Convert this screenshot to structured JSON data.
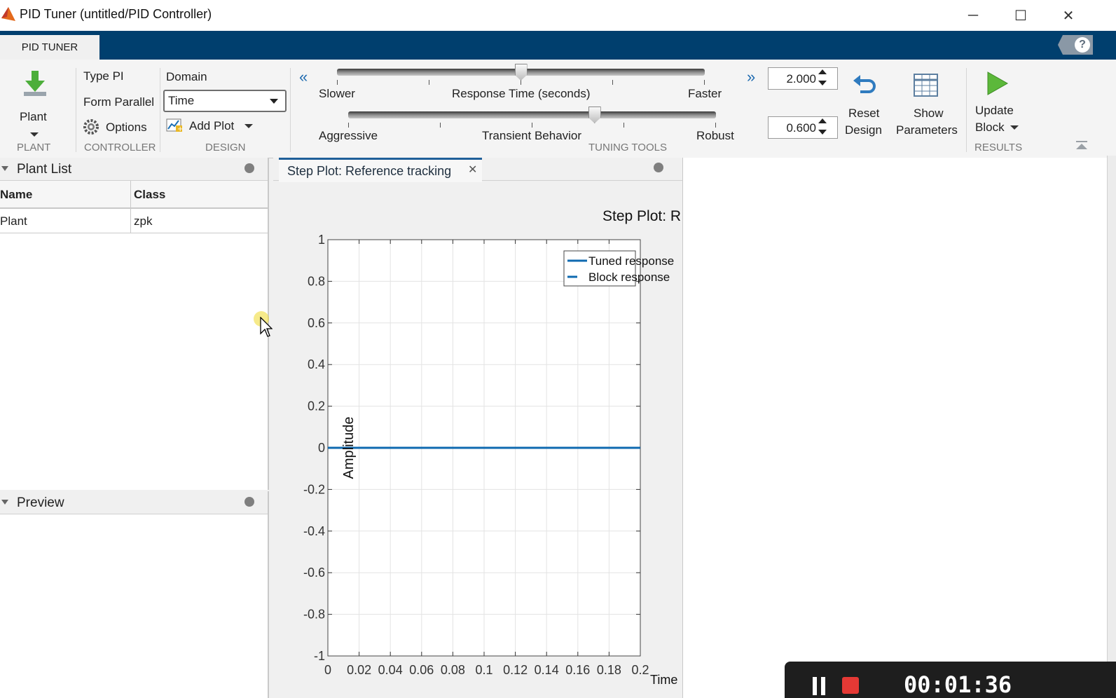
{
  "window": {
    "title": "PID Tuner (untitled/PID Controller)",
    "minimize": "─",
    "maximize": "☐",
    "close": "✕"
  },
  "tabs": {
    "active": "PID TUNER",
    "help": "?"
  },
  "ribbon": {
    "plant": {
      "button": "Plant",
      "group": "PLANT"
    },
    "controller": {
      "type": "Type PI",
      "form": "Form Parallel",
      "options": "Options",
      "group": "CONTROLLER"
    },
    "design": {
      "domain_label": "Domain",
      "domain_value": "Time",
      "add_plot": "Add Plot",
      "group": "DESIGN"
    },
    "tuning": {
      "slower": "Slower",
      "response_time": "Response Time (seconds)",
      "faster": "Faster",
      "aggressive": "Aggressive",
      "transient": "Transient Behavior",
      "robust": "Robust",
      "response_time_value": "2.000",
      "transient_value": "0.600",
      "response_slider_fraction": 0.5,
      "transient_slider_fraction": 0.67,
      "group": "TUNING TOOLS"
    },
    "reset": {
      "line1": "Reset",
      "line2": "Design"
    },
    "show": {
      "line1": "Show",
      "line2": "Parameters"
    },
    "results": {
      "line1": "Update",
      "line2": "Block",
      "group": "RESULTS"
    }
  },
  "plant_list": {
    "title": "Plant List",
    "columns": [
      "Name",
      "Class"
    ],
    "rows": [
      {
        "name": "Plant",
        "class": "zpk"
      }
    ]
  },
  "preview": {
    "title": "Preview"
  },
  "plot_tab": {
    "title": "Step Plot: Reference tracking"
  },
  "colors": {
    "accent": "#003f6e",
    "line": "#0f6ab0"
  },
  "chart_data": {
    "type": "line",
    "title": "Step Plot: R",
    "xlabel": "Time",
    "ylabel": "Amplitude",
    "xlim": [
      0,
      0.2
    ],
    "ylim": [
      -1,
      1
    ],
    "x_ticks": [
      "0",
      "0.02",
      "0.04",
      "0.06",
      "0.08",
      "0.1",
      "0.12",
      "0.14",
      "0.16",
      "0.18",
      "0.2"
    ],
    "y_ticks": [
      "1",
      "0.8",
      "0.6",
      "0.4",
      "0.2",
      "0",
      "-0.2",
      "-0.4",
      "-0.6",
      "-0.8",
      "-1"
    ],
    "grid": true,
    "legend": "top-right",
    "series": [
      {
        "name": "Tuned response",
        "style": "solid",
        "x": [
          0,
          0.2
        ],
        "y": [
          0,
          0
        ]
      },
      {
        "name": "Block response",
        "style": "dashed",
        "x": [
          0,
          0.2
        ],
        "y": [
          0,
          0
        ]
      }
    ]
  },
  "recorder": {
    "time": "00:01:36"
  }
}
